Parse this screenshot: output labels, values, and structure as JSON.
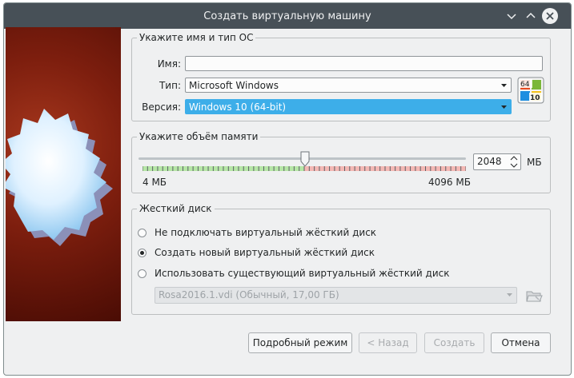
{
  "window": {
    "title": "Создать виртуальную машину"
  },
  "titlebar_icons": [
    "chevron-down-icon",
    "chevron-up-icon",
    "close-icon"
  ],
  "os_group": {
    "legend": "Укажите имя и тип ОС",
    "name_label": "Имя:",
    "name_value": "",
    "type_label": "Тип:",
    "type_value": "Microsoft Windows",
    "version_label": "Версия:",
    "version_value": "Windows 10 (64-bit)",
    "os_badge": {
      "top": "64",
      "bottom": "10"
    }
  },
  "memory_group": {
    "legend": "Укажите объём памяти",
    "value": "2048",
    "unit": "МБ",
    "min_label": "4 МБ",
    "max_label": "4096 МБ",
    "slider_level_fraction": 0.5
  },
  "disk_group": {
    "legend": "Жесткий диск",
    "options": [
      {
        "label": "Не подключать виртуальный жёсткий диск",
        "checked": false
      },
      {
        "label": "Создать новый виртуальный жёсткий диск",
        "checked": true
      },
      {
        "label": "Использовать существующий виртуальный жёсткий диск",
        "checked": false
      }
    ],
    "existing_disk": "Rosa2016.1.vdi (Обычный, 17,00 ГБ)"
  },
  "buttons": {
    "expert": "Подробный режим",
    "back": "< Назад",
    "create": "Создать",
    "cancel": "Отмена"
  },
  "colors": {
    "titlebar": "#475057",
    "selection": "#3daee9",
    "accent_red": "#7d1e0e"
  }
}
